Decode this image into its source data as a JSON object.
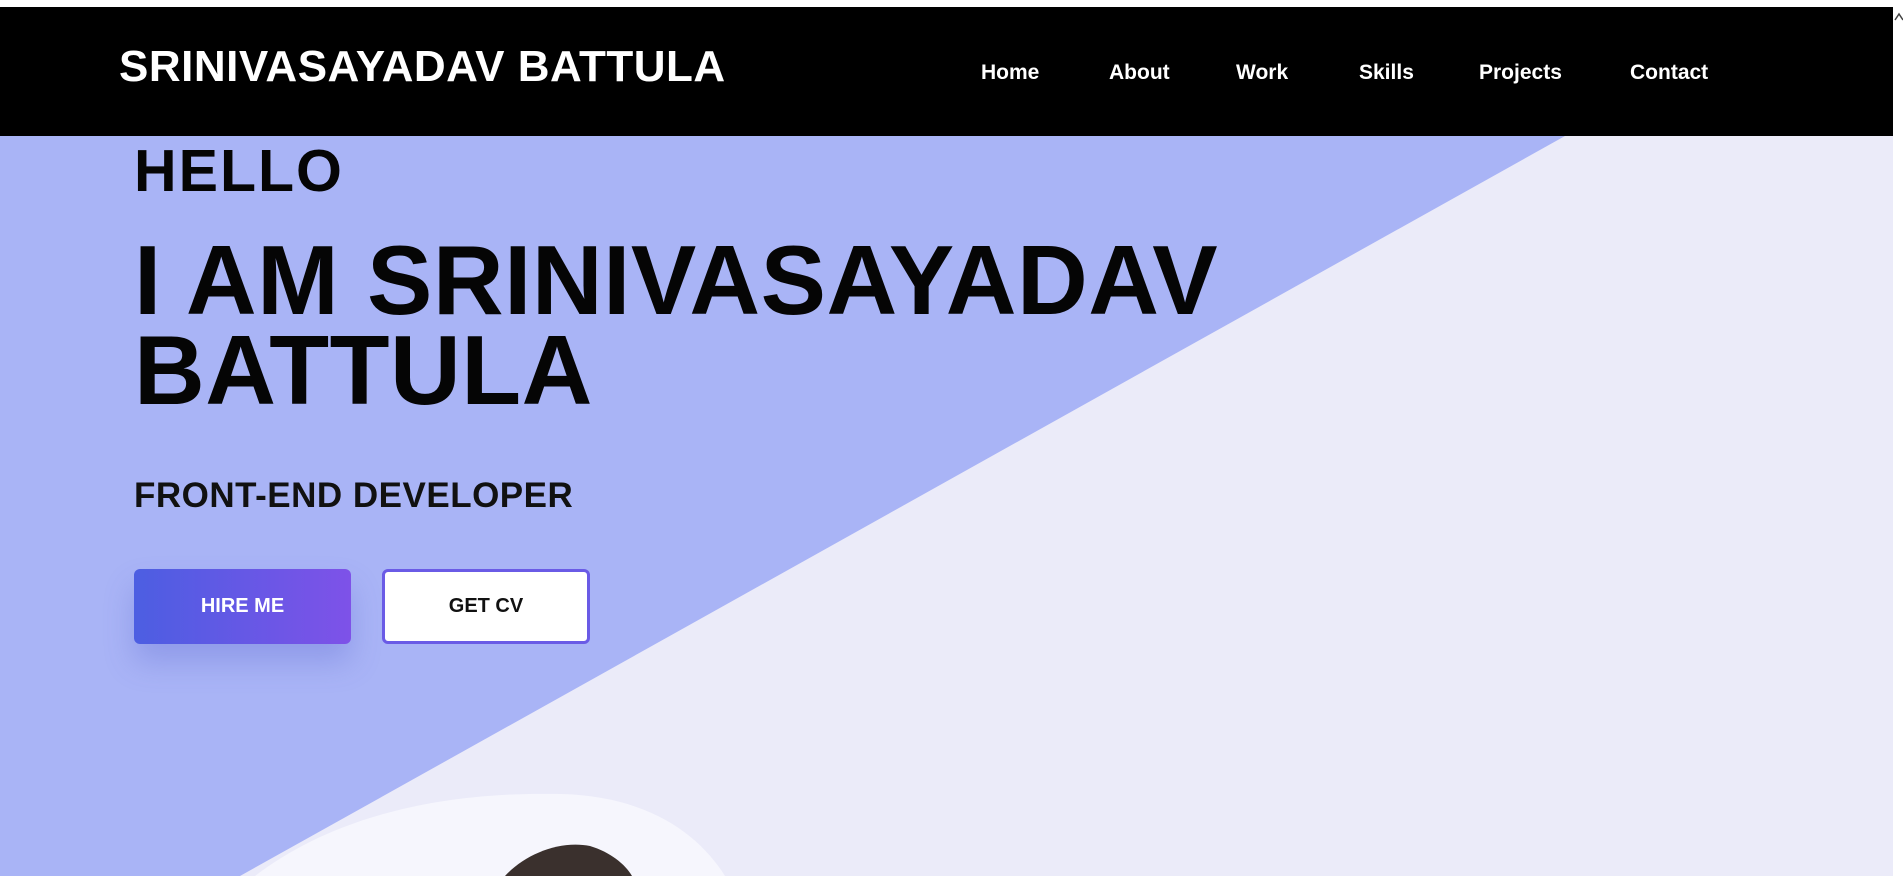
{
  "header": {
    "brand": "SRINIVASAYADAV BATTULA",
    "nav": [
      "Home",
      "About",
      "Work",
      "Skills",
      "Projects",
      "Contact"
    ]
  },
  "hero": {
    "greeting": "HELLO",
    "headline": "I AM SRINIVASAYADAV BATTULA",
    "role": "FRONT-END DEVELOPER",
    "hire_label": "HIRE ME",
    "cv_label": "GET CV"
  },
  "colors": {
    "nav_bg": "#000000",
    "hero_accent": "#a9b4f6",
    "hero_bg": "#ebebf9",
    "button_gradient_start": "#4c5ee2",
    "button_gradient_end": "#7e52e8"
  },
  "icons": {
    "scroll_up": "chevron-up-icon"
  }
}
